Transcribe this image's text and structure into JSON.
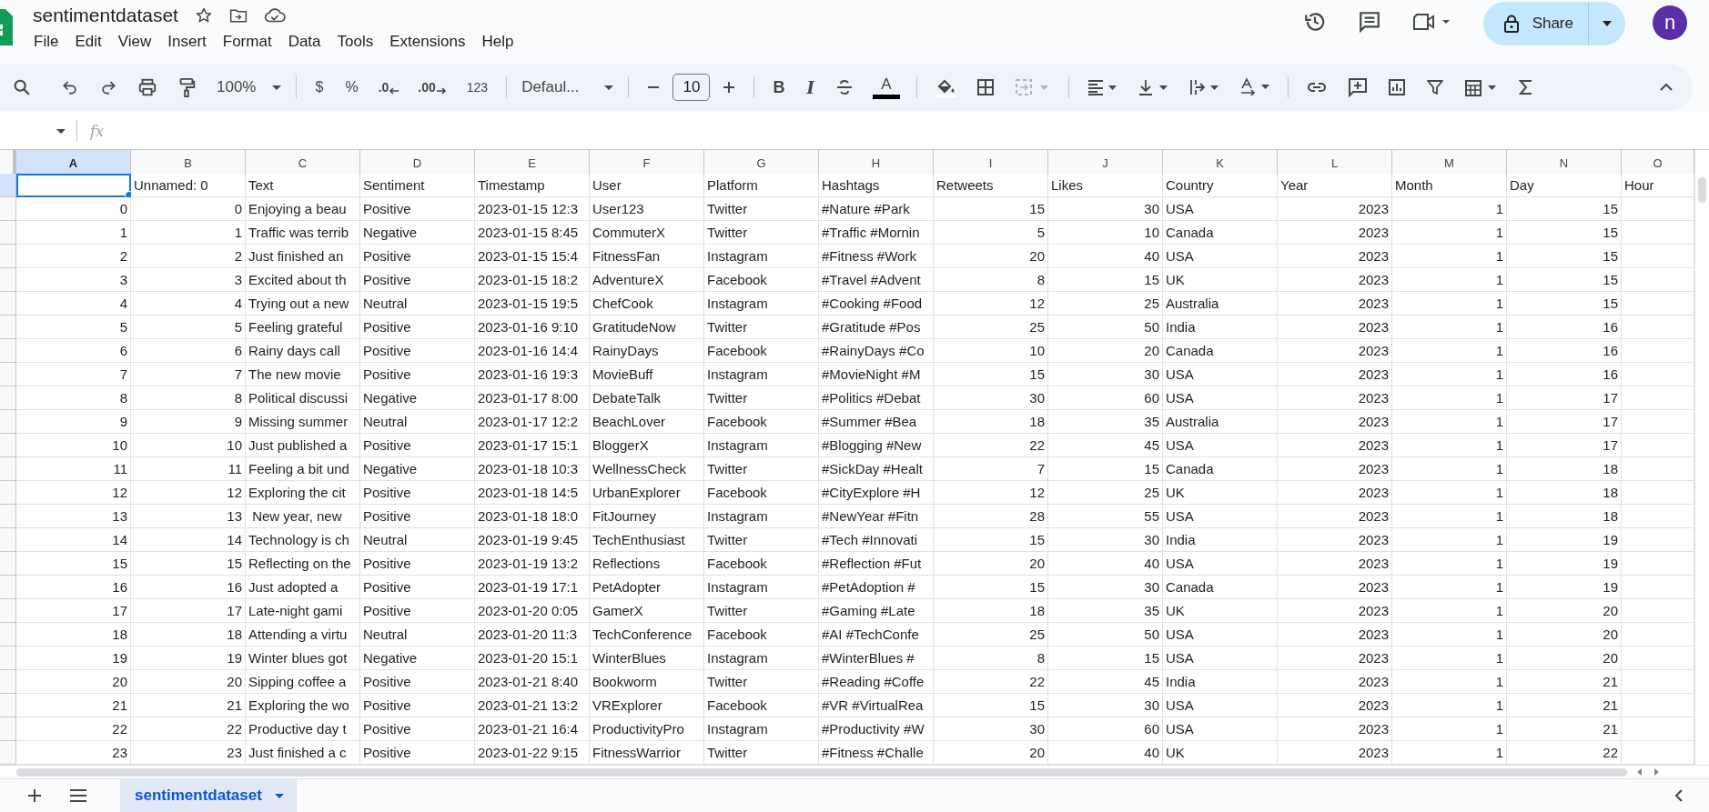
{
  "document": {
    "title": "sentimentdataset"
  },
  "menu": [
    "File",
    "Edit",
    "View",
    "Insert",
    "Format",
    "Data",
    "Tools",
    "Extensions",
    "Help"
  ],
  "share": {
    "label": "Share"
  },
  "account": {
    "initial": "n"
  },
  "toolbar": {
    "zoom": "100%",
    "currency": "$",
    "percent": "%",
    "decrease_decimal": ".0",
    "increase_decimal": ".00",
    "number_format": "123",
    "font": "Defaul...",
    "font_size": "10",
    "bold": "B",
    "italic": "I",
    "text_color": "A"
  },
  "formula_bar": {
    "fx": "fx"
  },
  "columns": [
    {
      "letter": "A",
      "selected": true,
      "numeric": true
    },
    {
      "letter": "B",
      "selected": false,
      "numeric": true
    },
    {
      "letter": "C",
      "selected": false,
      "numeric": false
    },
    {
      "letter": "D",
      "selected": false,
      "numeric": false
    },
    {
      "letter": "E",
      "selected": false,
      "numeric": false
    },
    {
      "letter": "F",
      "selected": false,
      "numeric": false
    },
    {
      "letter": "G",
      "selected": false,
      "numeric": false
    },
    {
      "letter": "H",
      "selected": false,
      "numeric": false
    },
    {
      "letter": "I",
      "selected": false,
      "numeric": true
    },
    {
      "letter": "J",
      "selected": false,
      "numeric": true
    },
    {
      "letter": "K",
      "selected": false,
      "numeric": false
    },
    {
      "letter": "L",
      "selected": false,
      "numeric": true
    },
    {
      "letter": "M",
      "selected": false,
      "numeric": true
    },
    {
      "letter": "N",
      "selected": false,
      "numeric": true
    },
    {
      "letter": "O",
      "selected": false
    }
  ],
  "header_row": {
    "selected": true,
    "cells": [
      "Unnamed: 0",
      "Text",
      "Sentiment",
      "Timestamp",
      "User",
      "Platform",
      "Hashtags",
      "Retweets",
      "Likes",
      "Country",
      "Year",
      "Month",
      "Day",
      "Hour"
    ]
  },
  "rows": [
    {
      "cells": [
        "0",
        "0",
        "Enjoying a beau",
        "Positive",
        "2023-01-15 12:3",
        "User123",
        "Twitter",
        "#Nature #Park",
        "15",
        "30",
        "USA",
        "2023",
        "1",
        "15"
      ]
    },
    {
      "cells": [
        "1",
        "1",
        "Traffic was terrib",
        "Negative",
        "2023-01-15 8:45",
        "CommuterX",
        "Twitter",
        "#Traffic #Mornin",
        "5",
        "10",
        "Canada",
        "2023",
        "1",
        "15"
      ]
    },
    {
      "cells": [
        "2",
        "2",
        "Just finished an",
        "Positive",
        "2023-01-15 15:4",
        "FitnessFan",
        "Instagram",
        "#Fitness #Work",
        "20",
        "40",
        "USA",
        "2023",
        "1",
        "15"
      ]
    },
    {
      "cells": [
        "3",
        "3",
        "Excited about th",
        "Positive",
        "2023-01-15 18:2",
        "AdventureX",
        "Facebook",
        "#Travel #Advent",
        "8",
        "15",
        "UK",
        "2023",
        "1",
        "15"
      ]
    },
    {
      "cells": [
        "4",
        "4",
        "Trying out a new",
        "Neutral",
        "2023-01-15 19:5",
        "ChefCook",
        "Instagram",
        "#Cooking #Food",
        "12",
        "25",
        "Australia",
        "2023",
        "1",
        "15"
      ]
    },
    {
      "cells": [
        "5",
        "5",
        "Feeling grateful",
        "Positive",
        "2023-01-16 9:10",
        "GratitudeNow",
        "Twitter",
        "#Gratitude #Pos",
        "25",
        "50",
        "India",
        "2023",
        "1",
        "16"
      ]
    },
    {
      "cells": [
        "6",
        "6",
        "Rainy days call",
        "Positive",
        "2023-01-16 14:4",
        "RainyDays",
        "Facebook",
        "#RainyDays #Co",
        "10",
        "20",
        "Canada",
        "2023",
        "1",
        "16"
      ]
    },
    {
      "cells": [
        "7",
        "7",
        "The new movie",
        "Positive",
        "2023-01-16 19:3",
        "MovieBuff",
        "Instagram",
        "#MovieNight #M",
        "15",
        "30",
        "USA",
        "2023",
        "1",
        "16"
      ]
    },
    {
      "cells": [
        "8",
        "8",
        "Political discussi",
        "Negative",
        "2023-01-17 8:00",
        "DebateTalk",
        "Twitter",
        "#Politics #Debat",
        "30",
        "60",
        "USA",
        "2023",
        "1",
        "17"
      ]
    },
    {
      "cells": [
        "9",
        "9",
        "Missing summer",
        "Neutral",
        "2023-01-17 12:2",
        "BeachLover",
        "Facebook",
        "#Summer #Bea",
        "18",
        "35",
        "Australia",
        "2023",
        "1",
        "17"
      ]
    },
    {
      "cells": [
        "10",
        "10",
        "Just published a",
        "Positive",
        "2023-01-17 15:1",
        "BloggerX",
        "Instagram",
        "#Blogging #New",
        "22",
        "45",
        "USA",
        "2023",
        "1",
        "17"
      ]
    },
    {
      "cells": [
        "11",
        "11",
        "Feeling a bit und",
        "Negative",
        "2023-01-18 10:3",
        "WellnessCheck",
        "Twitter",
        "#SickDay #Healt",
        "7",
        "15",
        "Canada",
        "2023",
        "1",
        "18"
      ]
    },
    {
      "cells": [
        "12",
        "12",
        "Exploring the cit",
        "Positive",
        "2023-01-18 14:5",
        "UrbanExplorer",
        "Facebook",
        "#CityExplore #H",
        "12",
        "25",
        "UK",
        "2023",
        "1",
        "18"
      ]
    },
    {
      "cells": [
        "13",
        "13",
        " New year, new",
        "Positive",
        "2023-01-18 18:0",
        "FitJourney",
        "Instagram",
        "#NewYear #Fitn",
        "28",
        "55",
        "USA",
        "2023",
        "1",
        "18"
      ]
    },
    {
      "cells": [
        "14",
        "14",
        "Technology is ch",
        "Neutral",
        "2023-01-19 9:45",
        "TechEnthusiast",
        "Twitter",
        "#Tech #Innovati",
        "15",
        "30",
        "India",
        "2023",
        "1",
        "19"
      ]
    },
    {
      "cells": [
        "15",
        "15",
        "Reflecting on the",
        "Positive",
        "2023-01-19 13:2",
        "Reflections",
        "Facebook",
        "#Reflection #Fut",
        "20",
        "40",
        "USA",
        "2023",
        "1",
        "19"
      ]
    },
    {
      "cells": [
        "16",
        "16",
        "Just adopted a",
        "Positive",
        "2023-01-19 17:1",
        "PetAdopter",
        "Instagram",
        "#PetAdoption #",
        "15",
        "30",
        "Canada",
        "2023",
        "1",
        "19"
      ]
    },
    {
      "cells": [
        "17",
        "17",
        "Late-night gami",
        "Positive",
        "2023-01-20 0:05",
        "GamerX",
        "Twitter",
        "#Gaming #Late",
        "18",
        "35",
        "UK",
        "2023",
        "1",
        "20"
      ]
    },
    {
      "cells": [
        "18",
        "18",
        "Attending a virtu",
        "Neutral",
        "2023-01-20 11:3",
        "TechConference",
        "Facebook",
        "#AI #TechConfe",
        "25",
        "50",
        "USA",
        "2023",
        "1",
        "20"
      ]
    },
    {
      "cells": [
        "19",
        "19",
        "Winter blues got",
        "Negative",
        "2023-01-20 15:1",
        "WinterBlues",
        "Instagram",
        "#WinterBlues #",
        "8",
        "15",
        "USA",
        "2023",
        "1",
        "20"
      ]
    },
    {
      "cells": [
        "20",
        "20",
        "Sipping coffee a",
        "Positive",
        "2023-01-21 8:40",
        "Bookworm",
        "Twitter",
        "#Reading #Coffe",
        "22",
        "45",
        "India",
        "2023",
        "1",
        "21"
      ]
    },
    {
      "cells": [
        "21",
        "21",
        "Exploring the wo",
        "Positive",
        "2023-01-21 13:2",
        "VRExplorer",
        "Facebook",
        "#VR #VirtualRea",
        "15",
        "30",
        "USA",
        "2023",
        "1",
        "21"
      ]
    },
    {
      "cells": [
        "22",
        "22",
        "Productive day t",
        "Positive",
        "2023-01-21 16:4",
        "ProductivityPro",
        "Instagram",
        "#Productivity #W",
        "30",
        "60",
        "USA",
        "2023",
        "1",
        "21"
      ]
    },
    {
      "cells": [
        "23",
        "23",
        "Just finished a c",
        "Positive",
        "2023-01-22 9:15",
        "FitnessWarrior",
        "Twitter",
        "#Fitness #Challe",
        "20",
        "40",
        "UK",
        "2023",
        "1",
        "22"
      ]
    }
  ],
  "sheet_tabs": [
    {
      "label": "sentimentdataset",
      "selected": true
    }
  ]
}
